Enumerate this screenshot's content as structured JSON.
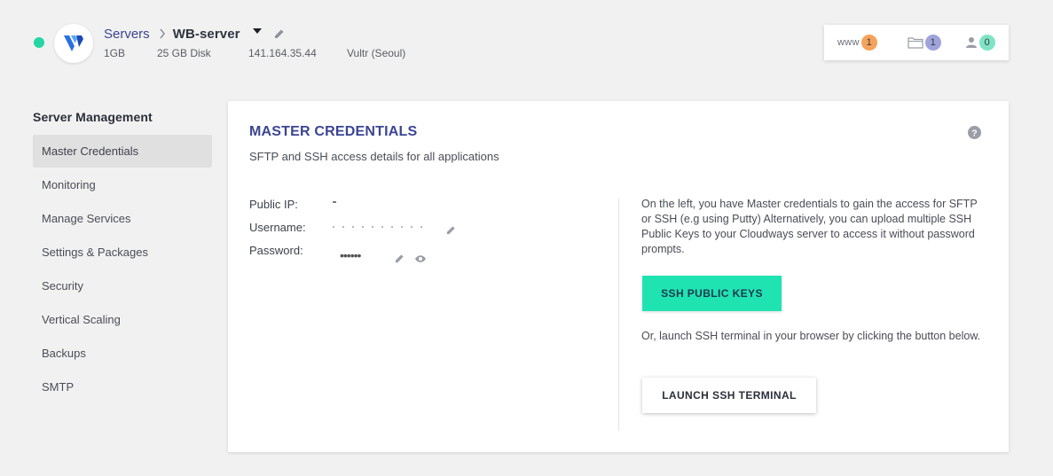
{
  "header": {
    "breadcrumb_root": "Servers",
    "server_name": "WB-server",
    "meta": {
      "size": "1GB",
      "disk": "25 GB Disk",
      "ip": "141.164.35.44",
      "provider": "Vultr (Seoul)"
    },
    "counters": [
      {
        "label": "www",
        "count": "1",
        "color": "#f5a35c"
      },
      {
        "icon": "folder-icon",
        "count": "1",
        "color": "#9ea3dc"
      },
      {
        "icon": "user-icon",
        "count": "0",
        "color": "#7fe3c6"
      }
    ],
    "status_color": "#24d6a4"
  },
  "sidebar": {
    "title": "Server Management",
    "items": [
      {
        "label": "Master Credentials",
        "active": true
      },
      {
        "label": "Monitoring"
      },
      {
        "label": "Manage Services"
      },
      {
        "label": "Settings & Packages"
      },
      {
        "label": "Security"
      },
      {
        "label": "Vertical Scaling"
      },
      {
        "label": "Backups"
      },
      {
        "label": "SMTP"
      }
    ]
  },
  "main": {
    "title": "MASTER CREDENTIALS",
    "subtitle": "SFTP and SSH access details for all applications",
    "credentials": {
      "public_ip_label": "Public IP:",
      "username_label": "Username:",
      "password_label": "Password:",
      "password_masked": "••••••"
    },
    "info_text": "On the left, you have Master credentials to gain the access for SFTP or SSH (e.g using Putty) Alternatively, you can upload multiple SSH Public Keys to your Cloudways server to access it without password prompts.",
    "ssh_keys_button": "SSH PUBLIC KEYS",
    "terminal_text": "Or, launch SSH terminal in your browser by clicking the button below.",
    "terminal_button": "LAUNCH SSH TERMINAL"
  },
  "colors": {
    "accent": "#3b4594",
    "primary_button": "#20e3b2"
  }
}
